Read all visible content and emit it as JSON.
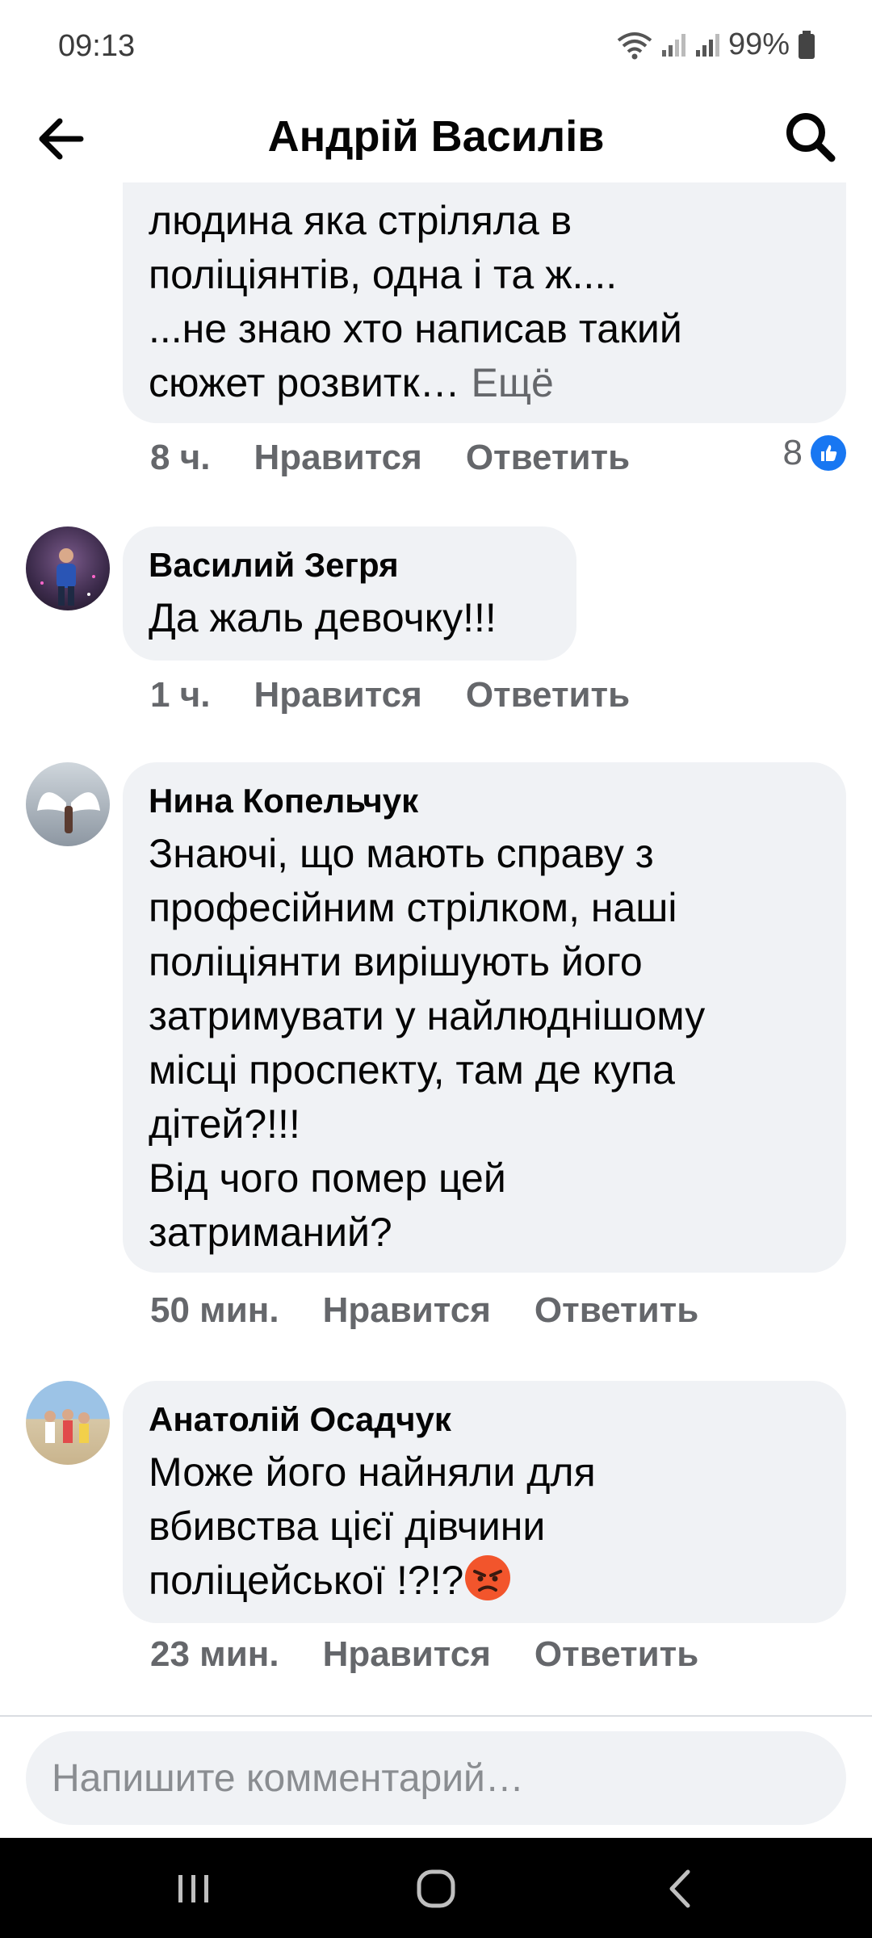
{
  "status_bar": {
    "time": "09:13",
    "battery": "99%"
  },
  "header": {
    "title": "Андрій Василів"
  },
  "comments": [
    {
      "text_lines": "людина яка стріляла в\nполіціянтів, одна і та ж....\n...не знаю хто написав такий\nсюжет розвитк…",
      "more": "Ещё",
      "time": "8 ч.",
      "like": "Нравится",
      "reply": "Ответить",
      "reaction_count": "8"
    },
    {
      "author": "Василий Зегря",
      "text": "Да жаль девочку!!!",
      "time": "1 ч.",
      "like": "Нравится",
      "reply": "Ответить"
    },
    {
      "author": "Нина Копельчук",
      "text": "Знаючі, що мають справу з\nпрофесійним стрілком, наші\nполіціянти вирішують його\nзатримувати у найлюднішому\nмісці проспекту, там де купа\nдітей?!!!\nВід чого помер цей\nзатриманий?",
      "time": "50 мин.",
      "like": "Нравится",
      "reply": "Ответить"
    },
    {
      "author": "Анатолій Осадчук",
      "text": "Може його найняли для\nвбивства цієї дівчини\nполіцейської !?!?",
      "time": "23 мин.",
      "like": "Нравится",
      "reply": "Ответить"
    }
  ],
  "composer": {
    "placeholder": "Напишите комментарий…"
  },
  "colors": {
    "accent": "#1877f2",
    "bubble": "#f0f2f5",
    "meta": "#65676b"
  }
}
